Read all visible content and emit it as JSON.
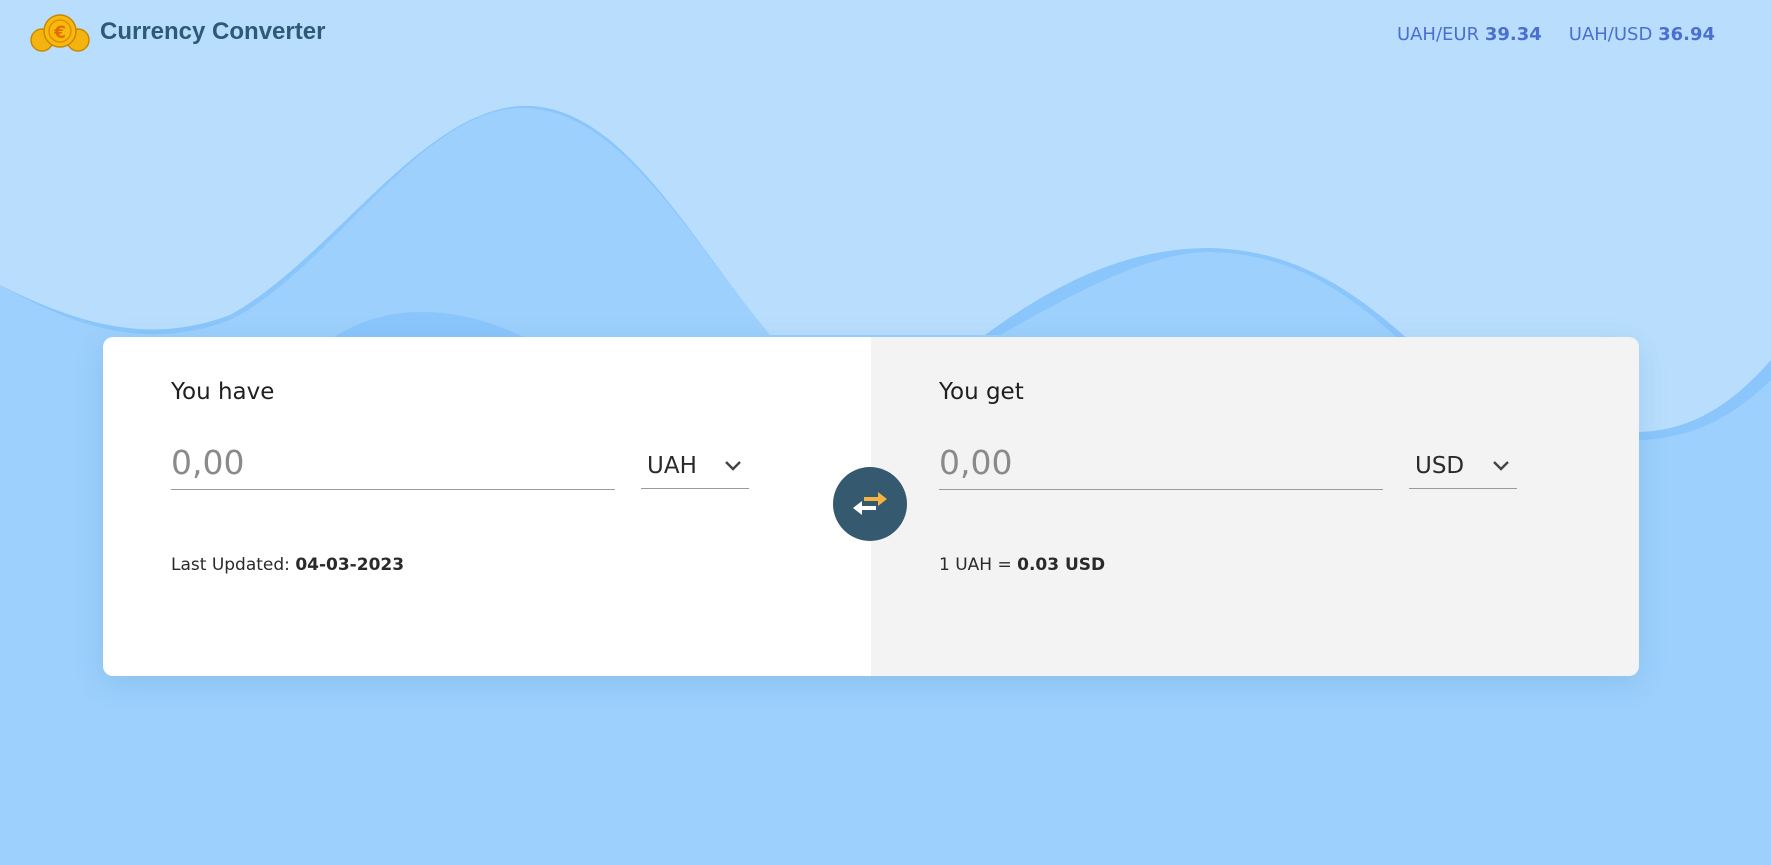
{
  "header": {
    "title": "Currency Converter",
    "logo_icon": "coins-icon",
    "rates": [
      {
        "pair": "UAH/EUR",
        "value": "39.34"
      },
      {
        "pair": "UAH/USD",
        "value": "36.94"
      }
    ]
  },
  "converter": {
    "have": {
      "heading": "You have",
      "amount_placeholder": "0,00",
      "currency": "UAH",
      "info_label": "Last Updated:",
      "info_value": "04-03-2023"
    },
    "get": {
      "heading": "You get",
      "amount_placeholder": "0,00",
      "currency": "USD",
      "info_label": "1 UAH =",
      "info_value": "0.03 USD"
    },
    "swap_icon": "swap-arrows-icon"
  },
  "colors": {
    "background": "#8ac6fb",
    "background_light": "#b9defd",
    "wave_mid": "#9dd0fc",
    "title": "#2e5a78",
    "rate_text": "#4a6fd0",
    "swap_button": "#35596f",
    "swap_arrow_accent": "#f5b342",
    "panel_right": "#f3f3f3"
  }
}
